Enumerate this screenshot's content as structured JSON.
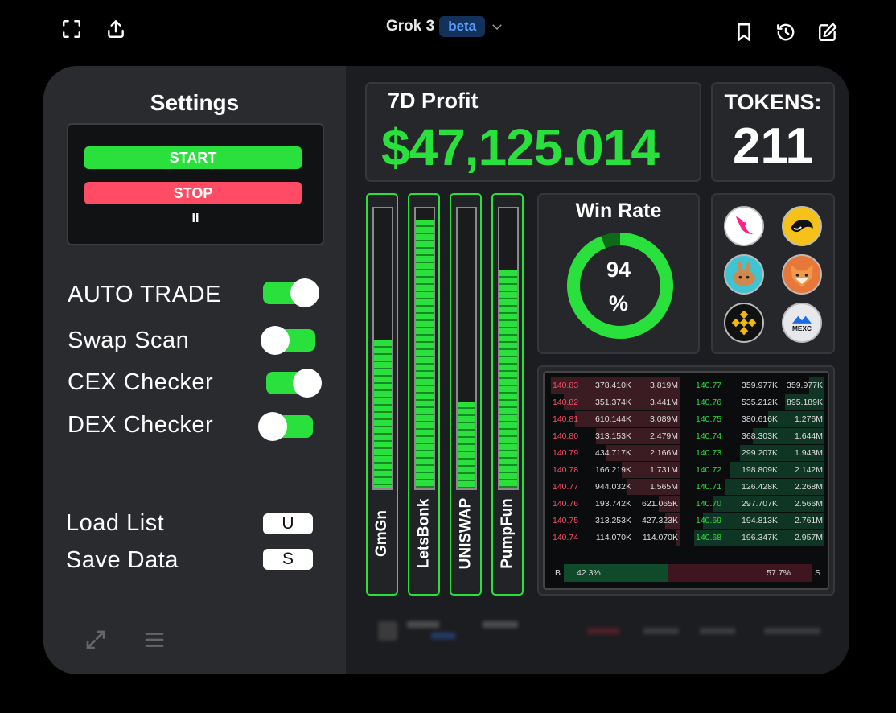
{
  "header": {
    "model_name": "Grok 3",
    "model_badge": "beta"
  },
  "settings": {
    "title": "Settings",
    "start_label": "START",
    "stop_label": "STOP",
    "pause_label": "II",
    "options": [
      {
        "label": "AUTO TRADE",
        "enabled": true
      },
      {
        "label": "Swap Scan",
        "enabled": false
      },
      {
        "label": "CEX Checker",
        "enabled": true
      },
      {
        "label": "DEX Checker",
        "enabled": false
      }
    ],
    "shortcuts": [
      {
        "label": "Load List",
        "key": "U"
      },
      {
        "label": "Save Data",
        "key": "S"
      }
    ]
  },
  "profit": {
    "label": "7D Profit",
    "value": "$47,125.014"
  },
  "tokens": {
    "label": "TOKENS:",
    "value": "211"
  },
  "platforms": [
    {
      "name": "GmGn",
      "level": 0.53
    },
    {
      "name": "LetsBonk",
      "level": 0.96
    },
    {
      "name": "UNISWAP",
      "level": 0.31
    },
    {
      "name": "PumpFun",
      "level": 0.78
    }
  ],
  "win_rate": {
    "title": "Win Rate",
    "value": "94",
    "unit": "%",
    "fraction": 0.94
  },
  "token_icons": [
    "uniswap-icon",
    "orca-icon",
    "pancakeswap-icon",
    "shiba-icon",
    "binance-icon",
    "mexc-icon"
  ],
  "mexc_label": "MEXC",
  "order_book": {
    "asks": [
      {
        "price": "140.83",
        "size": "378.410K",
        "total": "3.819M",
        "depth": 1.0
      },
      {
        "price": "140.82",
        "size": "351.374K",
        "total": "3.441M",
        "depth": 0.9
      },
      {
        "price": "140.81",
        "size": "610.144K",
        "total": "3.089M",
        "depth": 0.81
      },
      {
        "price": "140.80",
        "size": "313.153K",
        "total": "2.479M",
        "depth": 0.65
      },
      {
        "price": "140.79",
        "size": "434.717K",
        "total": "2.166M",
        "depth": 0.57
      },
      {
        "price": "140.78",
        "size": "166.219K",
        "total": "1.731M",
        "depth": 0.45
      },
      {
        "price": "140.77",
        "size": "944.032K",
        "total": "1.565M",
        "depth": 0.41
      },
      {
        "price": "140.76",
        "size": "193.742K",
        "total": "621.065K",
        "depth": 0.16
      },
      {
        "price": "140.75",
        "size": "313.253K",
        "total": "427.323K",
        "depth": 0.11
      },
      {
        "price": "140.74",
        "size": "114.070K",
        "total": "114.070K",
        "depth": 0.03
      }
    ],
    "bids": [
      {
        "price": "140.77",
        "size": "359.977K",
        "total": "359.977K",
        "depth": 0.12
      },
      {
        "price": "140.76",
        "size": "535.212K",
        "total": "895.189K",
        "depth": 0.3
      },
      {
        "price": "140.75",
        "size": "380.616K",
        "total": "1.276M",
        "depth": 0.43
      },
      {
        "price": "140.74",
        "size": "368.303K",
        "total": "1.644M",
        "depth": 0.55
      },
      {
        "price": "140.73",
        "size": "299.207K",
        "total": "1.943M",
        "depth": 0.65
      },
      {
        "price": "140.72",
        "size": "198.809K",
        "total": "2.142M",
        "depth": 0.72
      },
      {
        "price": "140.71",
        "size": "126.428K",
        "total": "2.268M",
        "depth": 0.76
      },
      {
        "price": "140.70",
        "size": "297.707K",
        "total": "2.566M",
        "depth": 0.86
      },
      {
        "price": "140.69",
        "size": "194.813K",
        "total": "2.761M",
        "depth": 0.93
      },
      {
        "price": "140.68",
        "size": "196.347K",
        "total": "2.957M",
        "depth": 1.0
      }
    ],
    "buy_label": "B",
    "buy_pct": "42.3%",
    "sell_label": "S",
    "sell_pct": "57.7%",
    "buy_fraction": 0.423
  },
  "colors": {
    "accent_green": "#2ae03c",
    "stop_red": "#ff4b63",
    "ask_red": "#ff4b63",
    "bid_green": "#2ae03c",
    "beta_blue": "#5aa2ff"
  }
}
